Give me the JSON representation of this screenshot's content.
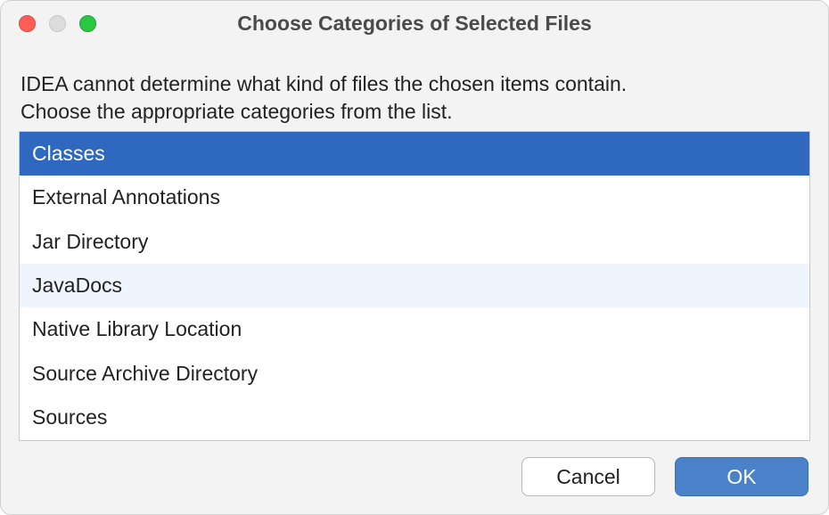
{
  "window": {
    "title": "Choose Categories of Selected Files"
  },
  "message": {
    "line1": "IDEA cannot determine what kind of files the chosen items contain.",
    "line2": "Choose the appropriate categories from the list."
  },
  "categories": {
    "items": [
      {
        "label": "Classes",
        "state": "selected"
      },
      {
        "label": "External Annotations",
        "state": "normal"
      },
      {
        "label": "Jar Directory",
        "state": "normal"
      },
      {
        "label": "JavaDocs",
        "state": "hover"
      },
      {
        "label": "Native Library Location",
        "state": "normal"
      },
      {
        "label": "Source Archive Directory",
        "state": "normal"
      },
      {
        "label": "Sources",
        "state": "normal"
      }
    ]
  },
  "buttons": {
    "cancel": "Cancel",
    "ok": "OK"
  }
}
